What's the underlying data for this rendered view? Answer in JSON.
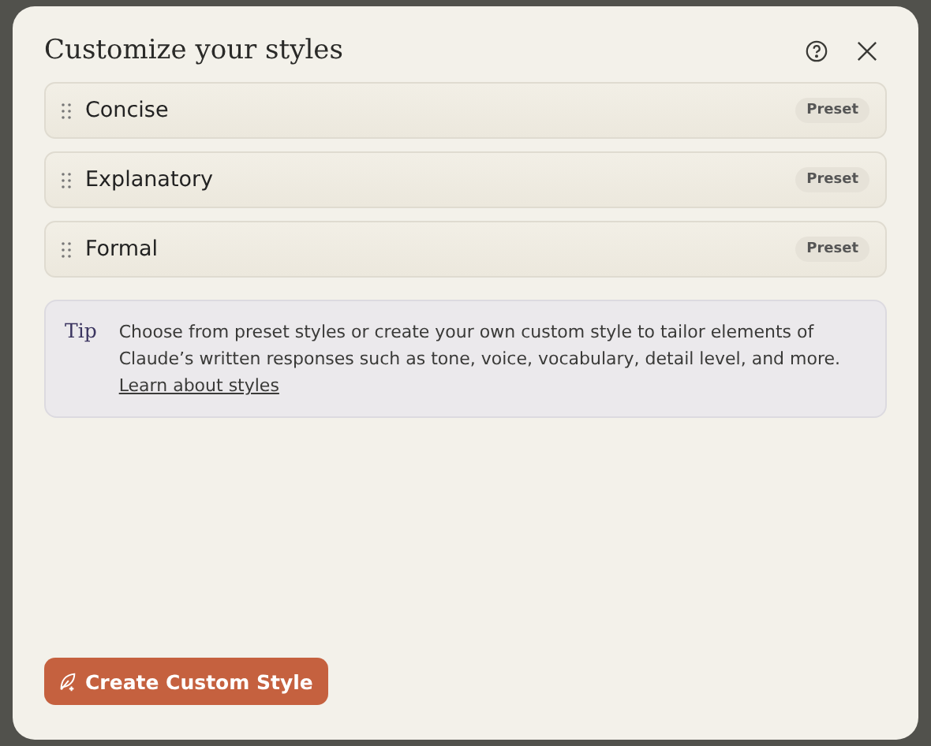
{
  "dialog": {
    "title": "Customize your styles"
  },
  "styles": [
    {
      "name": "Concise",
      "badge": "Preset"
    },
    {
      "name": "Explanatory",
      "badge": "Preset"
    },
    {
      "name": "Formal",
      "badge": "Preset"
    }
  ],
  "tip": {
    "label": "Tip",
    "text": "Choose from preset styles or create your own custom style to tailor elements of Claude’s written responses such as tone, voice, vocabulary, detail level, and more.",
    "link": "Learn about styles"
  },
  "create_button": "Create Custom Style"
}
